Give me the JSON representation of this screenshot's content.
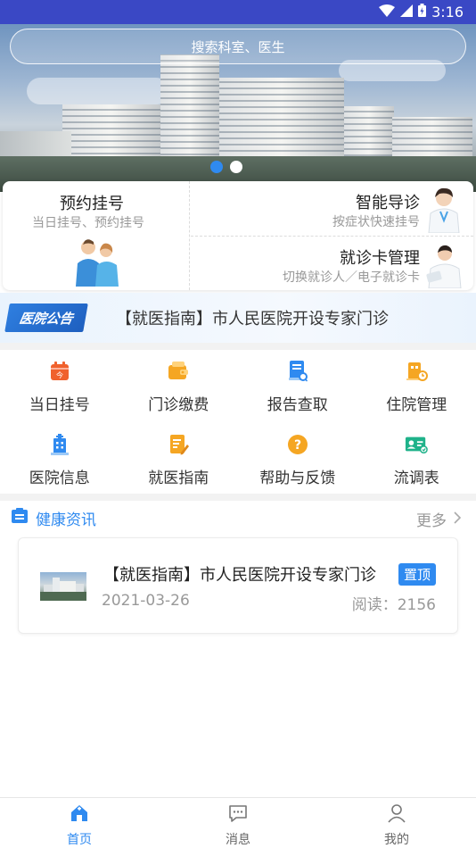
{
  "status_bar": {
    "time": "3:16"
  },
  "search": {
    "placeholder": "搜索科室、医生"
  },
  "services": {
    "appointment": {
      "title": "预约挂号",
      "subtitle": "当日挂号、预约挂号"
    },
    "smart_guide": {
      "title": "智能导诊",
      "subtitle": "按症状快速挂号"
    },
    "card_management": {
      "title": "就诊卡管理",
      "subtitle": "切换就诊人／电子就诊卡"
    }
  },
  "notice": {
    "logo_text": "医院公告",
    "text": "【就医指南】市人民医院开设专家门诊"
  },
  "grid": [
    {
      "label": "当日挂号",
      "icon": "calendar-today-icon",
      "color": "#f0612d"
    },
    {
      "label": "门诊缴费",
      "icon": "wallet-icon",
      "color": "#f5a623"
    },
    {
      "label": "报告查取",
      "icon": "report-search-icon",
      "color": "#2f8af0"
    },
    {
      "label": "住院管理",
      "icon": "inpatient-icon",
      "color": "#f5a623"
    },
    {
      "label": "医院信息",
      "icon": "hospital-building-icon",
      "color": "#2f8af0"
    },
    {
      "label": "就医指南",
      "icon": "guide-edit-icon",
      "color": "#f5a623"
    },
    {
      "label": "帮助与反馈",
      "icon": "help-icon",
      "color": "#f5a623"
    },
    {
      "label": "流调表",
      "icon": "id-card-icon",
      "color": "#1fb28a"
    }
  ],
  "health": {
    "title": "健康资讯",
    "more": "更多",
    "news": [
      {
        "title": "【就医指南】市人民医院开设专家门诊",
        "badge": "置顶",
        "date": "2021-03-26",
        "reads": "阅读：2156"
      }
    ]
  },
  "bottom_nav": [
    {
      "label": "首页",
      "icon": "home-icon",
      "active": true
    },
    {
      "label": "消息",
      "icon": "message-icon",
      "active": false
    },
    {
      "label": "我的",
      "icon": "user-icon",
      "active": false
    }
  ],
  "colors": {
    "accent": "#2f8af0",
    "status_bar": "#3a48c5"
  }
}
